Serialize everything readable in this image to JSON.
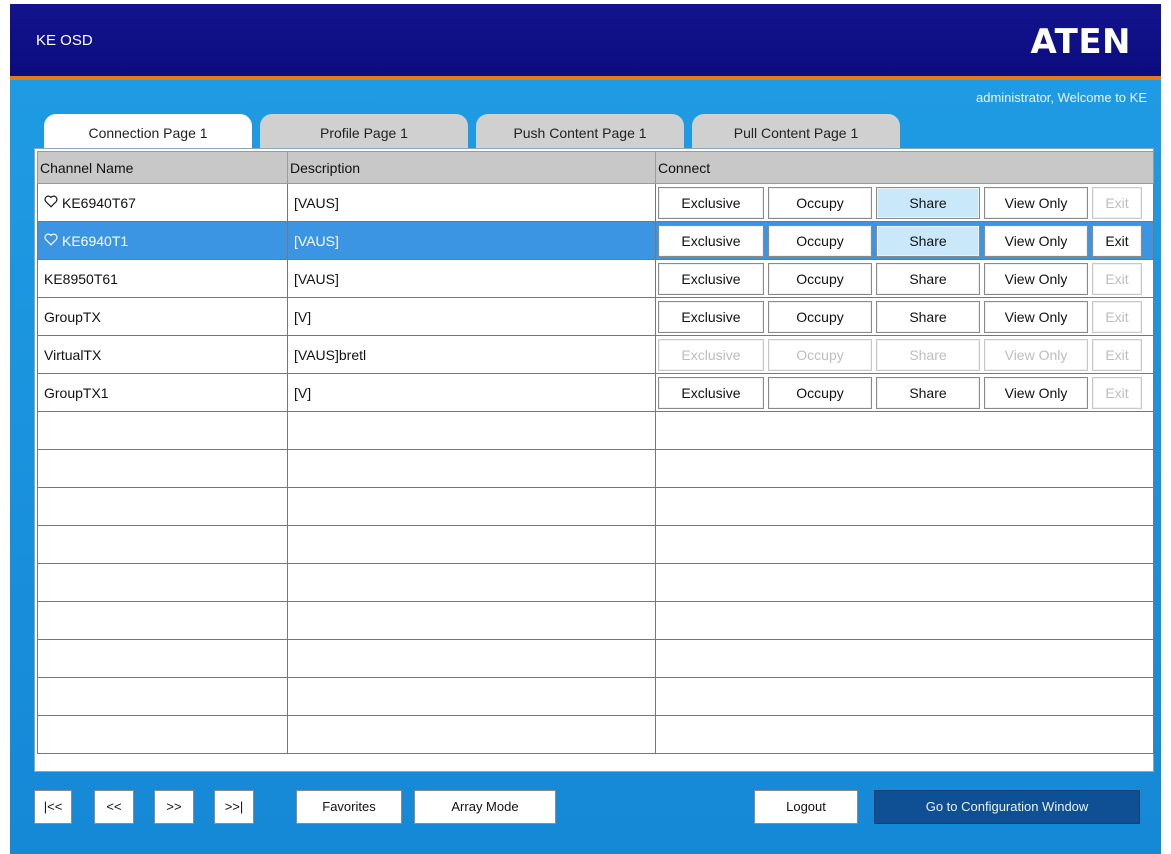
{
  "header": {
    "title": "KE OSD",
    "logo": "ATEN"
  },
  "welcome": "administrator, Welcome to KE",
  "tabs": [
    "Connection Page 1",
    "Profile Page 1",
    "Push Content Page 1",
    "Pull Content Page 1"
  ],
  "active_tab": 0,
  "columns": [
    "Channel Name",
    "Description",
    "Connect"
  ],
  "rows": [
    {
      "name": "KE6940T67",
      "favorite": true,
      "description": "[VAUS]",
      "exit_enabled": false,
      "share_active": true,
      "selected": false,
      "actions_enabled": true
    },
    {
      "name": "KE6940T1",
      "favorite": true,
      "description": "[VAUS]",
      "exit_enabled": true,
      "share_active": true,
      "selected": true,
      "actions_enabled": true
    },
    {
      "name": "KE8950T61",
      "favorite": false,
      "description": "[VAUS]",
      "exit_enabled": false,
      "share_active": false,
      "selected": false,
      "actions_enabled": true
    },
    {
      "name": "GroupTX",
      "favorite": false,
      "description": "[V]",
      "exit_enabled": false,
      "share_active": false,
      "selected": false,
      "actions_enabled": true
    },
    {
      "name": "VirtualTX",
      "favorite": false,
      "description": "[VAUS]bretl",
      "exit_enabled": false,
      "share_active": false,
      "selected": false,
      "actions_enabled": false
    },
    {
      "name": "GroupTX1",
      "favorite": false,
      "description": "[V]",
      "exit_enabled": false,
      "share_active": false,
      "selected": false,
      "actions_enabled": true
    }
  ],
  "empty_rows": 9,
  "actions": {
    "exclusive": "Exclusive",
    "occupy": "Occupy",
    "share": "Share",
    "view_only": "View Only",
    "exit": "Exit"
  },
  "nav": {
    "first": "|<<",
    "prev": "<<",
    "next": ">>",
    "last": ">>|"
  },
  "bottom": {
    "favorites": "Favorites",
    "array_mode": "Array Mode",
    "logout": "Logout",
    "config": "Go to Configuration Window"
  },
  "colors": {
    "header": "#0c0c80",
    "accent": "#e47a1c",
    "main": "#1a92dd",
    "selected_row": "#3c95e3",
    "share_active": "#c9e9fa"
  },
  "icons": {
    "favorite": "heart-icon"
  }
}
